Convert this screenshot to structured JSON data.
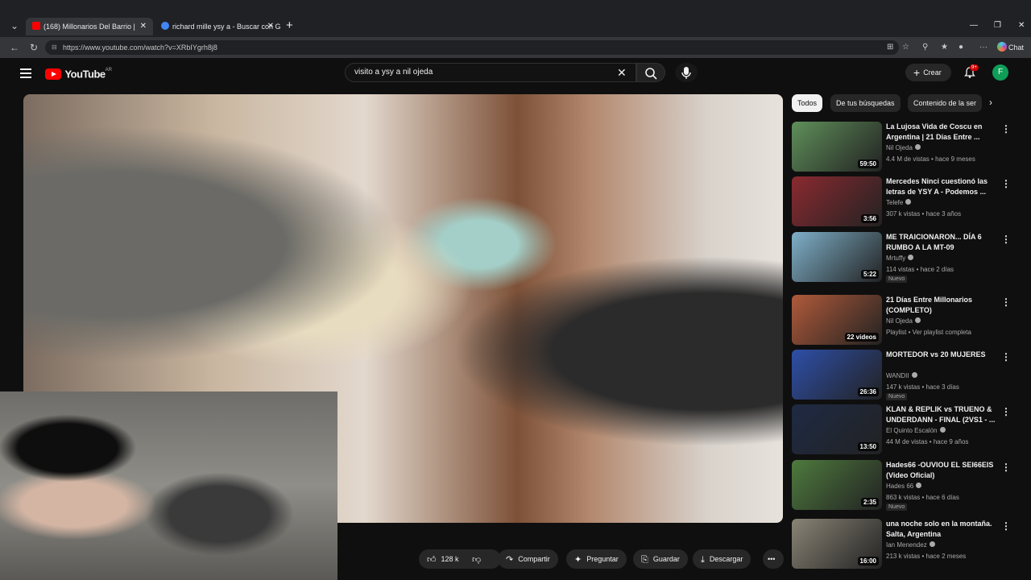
{
  "browser": {
    "tabs": [
      {
        "label": "(168) Millonarios Del Barrio |",
        "active": true
      },
      {
        "label": "richard mille ysy a - Buscar con Go",
        "active": false
      }
    ],
    "url": "https://www.youtube.com/watch?v=XRbIYgrh8j8",
    "chat_label": "Chat"
  },
  "youtube": {
    "logo_word": "YouTube",
    "country": "AR",
    "search_value": "visito a ysy a nil ojeda",
    "create_label": "Crear",
    "notifications": "9+",
    "avatar_letter": "F"
  },
  "actions": {
    "likes": "128 k",
    "share": "Compartir",
    "ask": "Preguntar",
    "save": "Guardar",
    "download": "Descargar"
  },
  "chips": [
    "Todos",
    "De tus búsquedas",
    "Contenido de la ser"
  ],
  "recommendations": [
    {
      "title": "La Lujosa Vida de Coscu en Argentina | 21 Días Entre ...",
      "channel": "Nil Ojeda",
      "views": "4.4 M de vistas",
      "age": "hace 9 meses",
      "duration": "59:50",
      "badge": "",
      "thumb_color": "#5f8f5a"
    },
    {
      "title": "Mercedes Ninci cuestionó las letras de YSY A - Podemos ...",
      "channel": "Telefe",
      "views": "307 k vistas",
      "age": "hace 3 años",
      "duration": "3:56",
      "badge": "",
      "thumb_color": "#8a2a30"
    },
    {
      "title": "ME TRAICIONARON... DÍA 6 RUMBO A LA MT-09",
      "channel": "Mrtuffy",
      "views": "114 vistas",
      "age": "hace 2 días",
      "duration": "5:22",
      "badge": "Nuevo",
      "thumb_color": "#7fb0c9"
    },
    {
      "title": "21 Días Entre Millonarios (COMPLETO)",
      "channel": "Nil Ojeda",
      "views": "Playlist",
      "age": "Ver playlist completa",
      "duration": "22 videos",
      "badge": "",
      "thumb_color": "#b05a3a"
    },
    {
      "title": "MORTEDOR vs 20 MUJERES",
      "channel": "WANDII",
      "views": "147 k vistas",
      "age": "hace 3 días",
      "duration": "26:36",
      "badge": "Nuevo",
      "thumb_color": "#2e4fa8"
    },
    {
      "title": "KLAN & REPLIK vs TRUENO & UNDERDANN - FINAL (2VS1 - ...",
      "channel": "El Quinto Escalón",
      "views": "44 M de vistas",
      "age": "hace 9 años",
      "duration": "13:50",
      "badge": "",
      "thumb_color": "#1e2a44"
    },
    {
      "title": "Hades66 -OUVIOU EL SEI66EIS (Video Oficial)",
      "channel": "Hades 66",
      "views": "863 k vistas",
      "age": "hace 6 días",
      "duration": "2:35",
      "badge": "Nuevo",
      "thumb_color": "#4e7a3e"
    },
    {
      "title": "una noche solo en la montaña. Salta, Argentina",
      "channel": "Ian Menendez",
      "views": "213 k vistas",
      "age": "hace 2 meses",
      "duration": "16:00",
      "badge": "",
      "thumb_color": "#8a8476"
    }
  ]
}
